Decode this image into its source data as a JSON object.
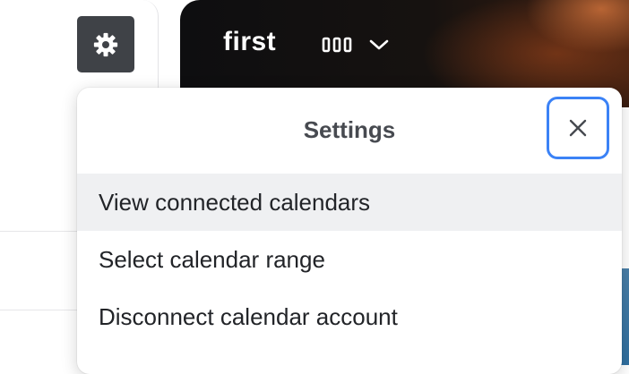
{
  "settings_button": {
    "icon": "gear-icon"
  },
  "calendar_header": {
    "title": "first",
    "view_toggle": {
      "icon": "columns-view-icon",
      "chevron": "chevron-down-icon"
    }
  },
  "settings_popover": {
    "title": "Settings",
    "close_icon": "close-icon",
    "items": [
      {
        "label": "View connected calendars",
        "highlighted": true
      },
      {
        "label": "Select calendar range",
        "highlighted": false
      },
      {
        "label": "Disconnect calendar account",
        "highlighted": false
      }
    ]
  },
  "colors": {
    "focus_ring": "#3b82f6",
    "settings_button_bg": "#3f4247",
    "highlight_bg": "#eff0f2"
  }
}
